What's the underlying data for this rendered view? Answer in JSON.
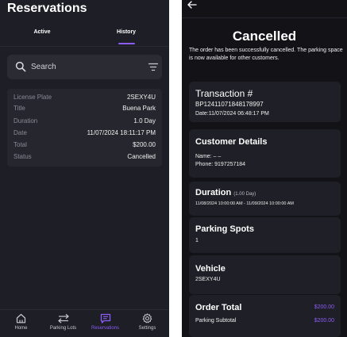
{
  "left": {
    "title": "Reservations",
    "tabs": [
      {
        "label": "Active",
        "selected": false
      },
      {
        "label": "History",
        "selected": true
      }
    ],
    "search": {
      "placeholder": "Search"
    },
    "reservation": {
      "rows": [
        {
          "key": "License Plate",
          "value": "2SEXY4U"
        },
        {
          "key": "Title",
          "value": "Buena Park"
        },
        {
          "key": "Duration",
          "value": "1.0 Day"
        },
        {
          "key": "Date",
          "value": "11/07/2024 18:11:17 PM"
        },
        {
          "key": "Total",
          "value": "$200.00"
        },
        {
          "key": "Status",
          "value": "Cancelled"
        }
      ]
    },
    "nav": [
      {
        "label": "Home",
        "icon": "home-icon"
      },
      {
        "label": "Parking Lots",
        "icon": "swap-arrows-icon"
      },
      {
        "label": "Reservations",
        "icon": "chat-list-icon",
        "selected": true
      },
      {
        "label": "Settings",
        "icon": "gear-icon"
      }
    ],
    "accent": "#8b5cf6"
  },
  "right": {
    "heading": "Cancelled",
    "message": "The order has been successfully cancelled. The parking space is now available for other customers.",
    "transaction": {
      "title": "Transaction #",
      "id": "BP12411071848178997",
      "date": "Date:11/07/2024 06:48:17 PM"
    },
    "customer": {
      "title": "Customer Details",
      "name": "Name: – –",
      "phone": "Phone: 9197257184"
    },
    "duration": {
      "title": "Duration",
      "days": "(1.00 Day)",
      "range": "11/08/2024 10:00:00 AM - 11/09/2024 10:00:00 AM"
    },
    "spots": {
      "title": "Parking Spots",
      "value": "1"
    },
    "vehicle": {
      "title": "Vehicle",
      "value": "2SEXY4U"
    },
    "order": {
      "title": "Order Total",
      "total": "$200.00",
      "subtotal_label": "Parking Subtotal",
      "subtotal": "$200.00"
    }
  }
}
